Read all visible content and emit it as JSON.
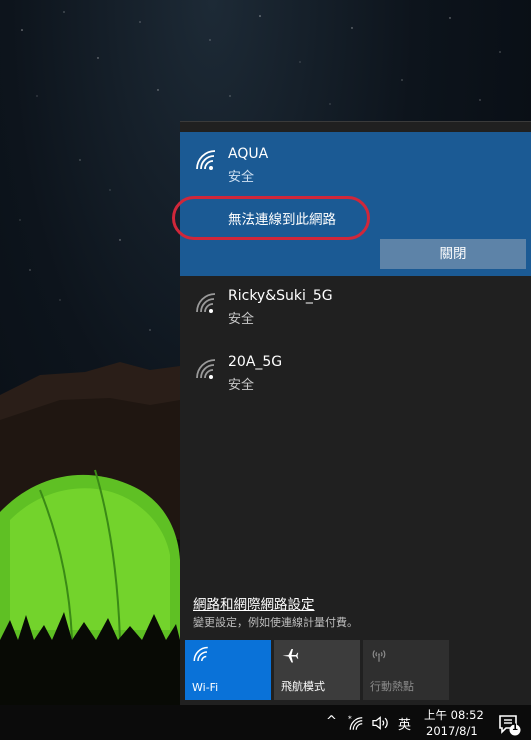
{
  "networks": [
    {
      "name": "AQUA",
      "status": "安全",
      "selected": true,
      "icon": "wifi-secure-icon"
    },
    {
      "name": "Ricky&Suki_5G",
      "status": "安全",
      "icon": "wifi-secure-icon"
    },
    {
      "name": "20A_5G",
      "status": "安全",
      "icon": "wifi-secure-icon"
    }
  ],
  "error_message": "無法連線到此網路",
  "disconnect_label": "關閉",
  "settings": {
    "link": "網路和網際網路設定",
    "description": "變更設定，例如使連線計量付費。"
  },
  "quick_actions": [
    {
      "label": "Wi-Fi",
      "icon": "wifi-icon",
      "active": true
    },
    {
      "label": "飛航模式",
      "icon": "airplane-icon",
      "active": false
    },
    {
      "label": "行動熱點",
      "icon": "hotspot-icon",
      "active": false,
      "disabled": true
    }
  ],
  "taskbar": {
    "chevron": "^",
    "ime": "英",
    "time": "上午 08:52",
    "date": "2017/8/1",
    "notification_count": "1"
  },
  "colors": {
    "selected_network_bg": "#1b5a94",
    "wifi_tile_active": "#0a72d8",
    "highlight_circle": "#d0273a"
  }
}
